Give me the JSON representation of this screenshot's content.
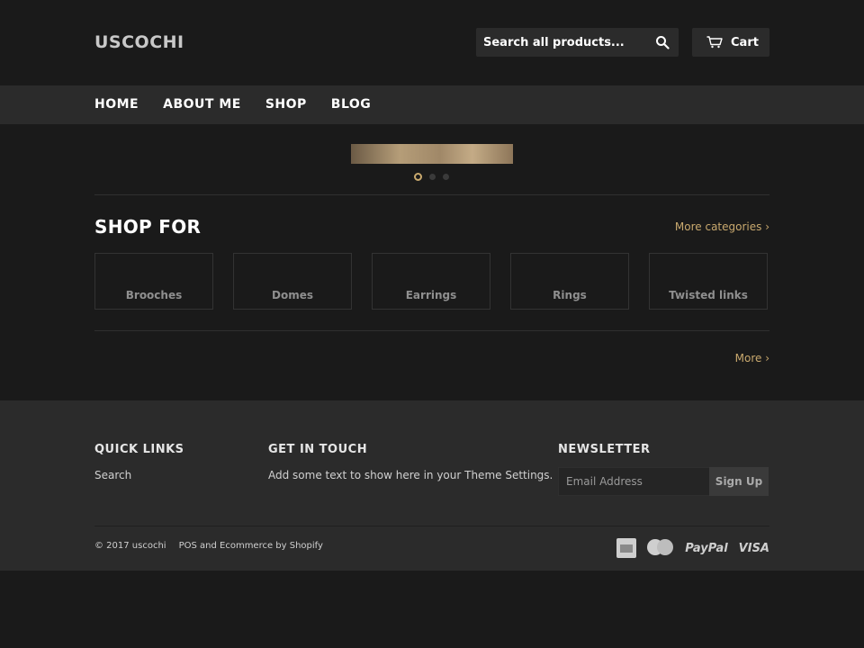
{
  "header": {
    "logo": "USCOCHI",
    "search_placeholder": "Search all products...",
    "cart_label": "Cart"
  },
  "nav": {
    "items": [
      {
        "label": "HOME"
      },
      {
        "label": "ABOUT ME"
      },
      {
        "label": "SHOP"
      },
      {
        "label": "BLOG"
      }
    ]
  },
  "slideshow": {
    "slide_count": 3,
    "active_index": 0,
    "accent_color": "#c9a96e"
  },
  "shop_for": {
    "title": "SHOP FOR",
    "more_categories": "More categories ›",
    "categories": [
      {
        "label": "Brooches"
      },
      {
        "label": "Domes"
      },
      {
        "label": "Earrings"
      },
      {
        "label": "Rings"
      },
      {
        "label": "Twisted links"
      }
    ],
    "more": "More ›"
  },
  "footer": {
    "quick_links": {
      "heading": "QUICK LINKS",
      "items": [
        {
          "label": "Search"
        }
      ]
    },
    "get_in_touch": {
      "heading": "GET IN TOUCH",
      "text": "Add some text to show here in your Theme Settings."
    },
    "newsletter": {
      "heading": "NEWSLETTER",
      "placeholder": "Email Address",
      "button": "Sign Up"
    },
    "copyright": "© 2017 uscochi",
    "powered_by": "POS and Ecommerce by Shopify",
    "payment_icons": [
      "amex-icon",
      "mastercard-icon",
      "paypal-icon",
      "visa-icon"
    ],
    "paypal_text": "PayPal",
    "visa_text": "VISA"
  },
  "colors": {
    "background": "#1a1a1a",
    "panel": "#2b2b2b",
    "accent": "#c9a96e"
  }
}
